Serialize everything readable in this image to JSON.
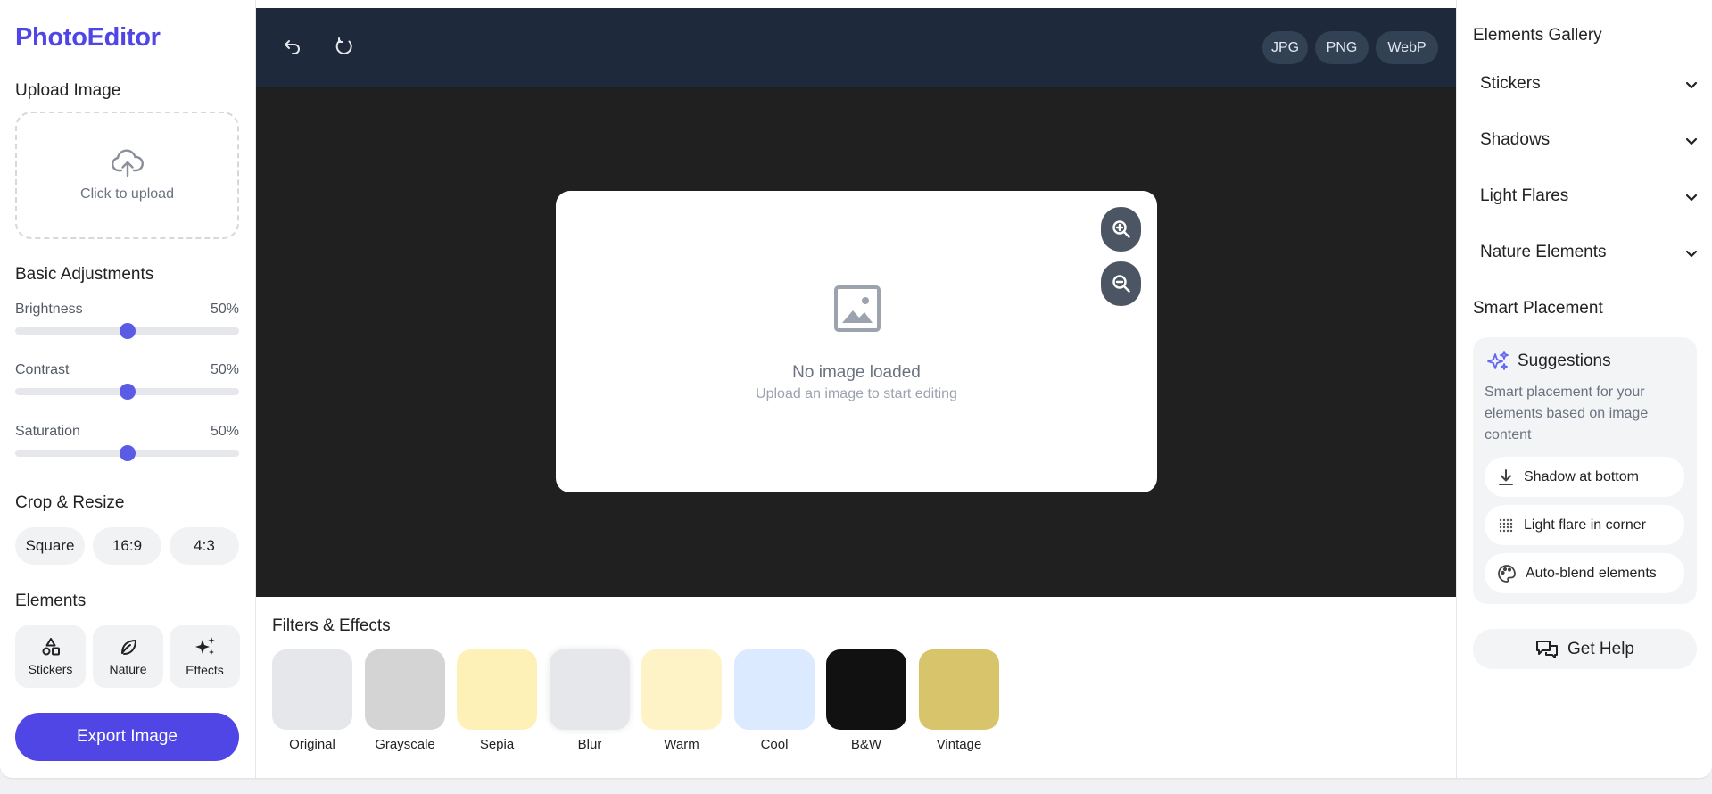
{
  "app": {
    "name": "PhotoEditor"
  },
  "left": {
    "upload_title": "Upload Image",
    "upload_text": "Click to upload",
    "basic_title": "Basic Adjustments",
    "sliders": [
      {
        "label": "Brightness",
        "value_text": "50%",
        "value": 0.5
      },
      {
        "label": "Contrast",
        "value_text": "50%",
        "value": 0.5
      },
      {
        "label": "Saturation",
        "value_text": "50%",
        "value": 0.5
      }
    ],
    "crop_title": "Crop & Resize",
    "crop_options": [
      "Square",
      "16:9",
      "4:3"
    ],
    "elements_title": "Elements",
    "elements": [
      "Stickers",
      "Nature",
      "Effects"
    ],
    "export_label": "Export Image"
  },
  "toolbar": {
    "formats": [
      "JPG",
      "PNG",
      "WebP"
    ]
  },
  "canvas": {
    "empty_title": "No image loaded",
    "empty_subtitle": "Upload an image to start editing"
  },
  "filters": {
    "title": "Filters & Effects",
    "items": [
      {
        "label": "Original",
        "color": "#e5e7eb"
      },
      {
        "label": "Grayscale",
        "color": "#d4d4d4"
      },
      {
        "label": "Sepia",
        "color": "#fdf1b8"
      },
      {
        "label": "Blur",
        "color": "#e5e7eb"
      },
      {
        "label": "Warm",
        "color": "#fef3c7"
      },
      {
        "label": "Cool",
        "color": "#dbeafe"
      },
      {
        "label": "B&W",
        "color": "#111111"
      },
      {
        "label": "Vintage",
        "color": "#d8c46a"
      }
    ]
  },
  "right": {
    "gallery_title": "Elements Gallery",
    "categories": [
      "Stickers",
      "Shadows",
      "Light Flares",
      "Nature Elements"
    ],
    "smart_title": "Smart Placement",
    "suggestions_title": "Suggestions",
    "suggestions_desc": "Smart placement for your elements based on image content",
    "suggestions": [
      "Shadow at bottom",
      "Light flare in corner",
      "Auto-blend elements"
    ],
    "help_label": "Get Help"
  },
  "colors": {
    "accent": "#4f46e5",
    "toolbar": "#1e293b",
    "canvas_bg": "#202020"
  }
}
